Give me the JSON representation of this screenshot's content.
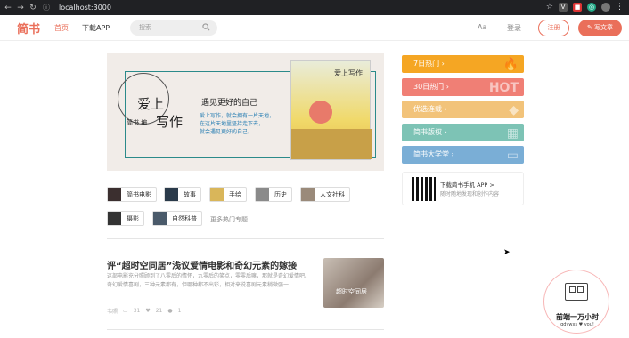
{
  "browser": {
    "url": "localhost:3000"
  },
  "header": {
    "logo": "简书",
    "nav_home": "首页",
    "nav_app": "下载APP",
    "search_placeholder": "搜索",
    "font_toggle": "Aa",
    "login": "登录",
    "register": "注册",
    "write": "写文章"
  },
  "banner": {
    "title_line1": "爱上",
    "title_line2": "写作",
    "author": "简书 编",
    "subtitle": "遇见更好的自己",
    "desc": "爱上写作，就会拥有一片天地，\n在这片天地里坚持走下去，\n就会遇见更好的自己。",
    "book_title": "爱上写作"
  },
  "topics": [
    {
      "label": "简书电影",
      "color": "#3b2f2f"
    },
    {
      "label": "故事",
      "color": "#2a3a4a"
    },
    {
      "label": "手绘",
      "color": "#d9b65a"
    },
    {
      "label": "历史",
      "color": "#8a8a8a"
    },
    {
      "label": "人文社科",
      "color": "#9a8a7a"
    },
    {
      "label": "摄影",
      "color": "#333333"
    },
    {
      "label": "自然科普",
      "color": "#4a5a6a"
    }
  ],
  "more_topics": "更多热门专题",
  "article": {
    "title": "评“超时空同居”浅议爱情电影和奇幻元素的嫁接",
    "body": "这部电影充分照顾到了八零后的情怀，九零后的笑点，零零后嘛，那就是奇幻爱情吧。奇幻爱情喜剧，三种元素都有，但哪种都不出彩，相对来说喜剧元素稍微强一...",
    "author": "韦照",
    "comments": "31",
    "likes": "21",
    "rewards": "1",
    "image_caption": "超时空同居"
  },
  "sidebar": {
    "buttons": [
      {
        "label": "7日热门",
        "color": "#f5a623"
      },
      {
        "label": "30日热门",
        "color": "#f07f75"
      },
      {
        "label": "优选连载",
        "color": "#f2c37a"
      },
      {
        "label": "简书版权",
        "color": "#7dc3b5"
      },
      {
        "label": "简书大学堂",
        "color": "#7aaed6"
      }
    ],
    "app_title": "下载简书手机 APP >",
    "app_sub": "随时随地发现和创作内容"
  },
  "badge": {
    "line1": "前端一万小时",
    "line2": "qdywxs ♥ you!"
  }
}
